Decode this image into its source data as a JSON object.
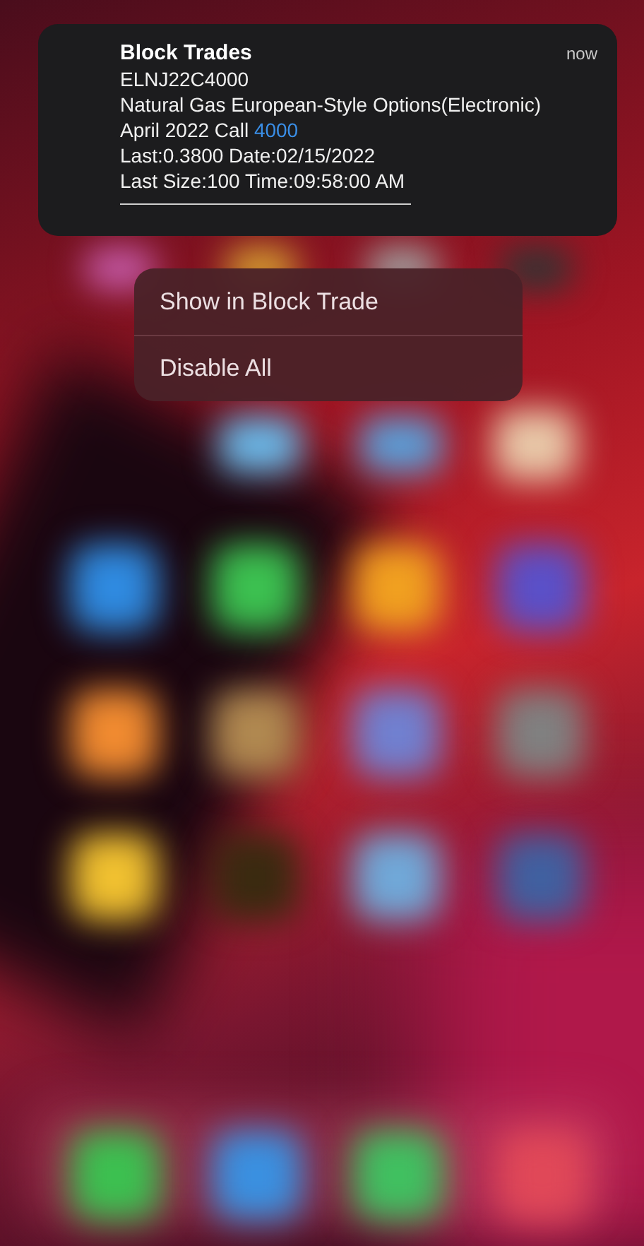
{
  "notification": {
    "app": "Block Trades",
    "time": "now",
    "lines": [
      {
        "text": "ELNJ22C4000"
      },
      {
        "text": "Natural Gas European-Style Options(Electronic)"
      },
      {
        "text": "April 2022 Call ",
        "link": "4000"
      },
      {
        "text": "Last:0.3800  Date:02/15/2022"
      },
      {
        "text": "Last Size:100  Time:09:58:00 AM"
      }
    ]
  },
  "menu": {
    "items": [
      {
        "label": "Show in Block Trade"
      },
      {
        "label": "Disable All"
      }
    ]
  }
}
